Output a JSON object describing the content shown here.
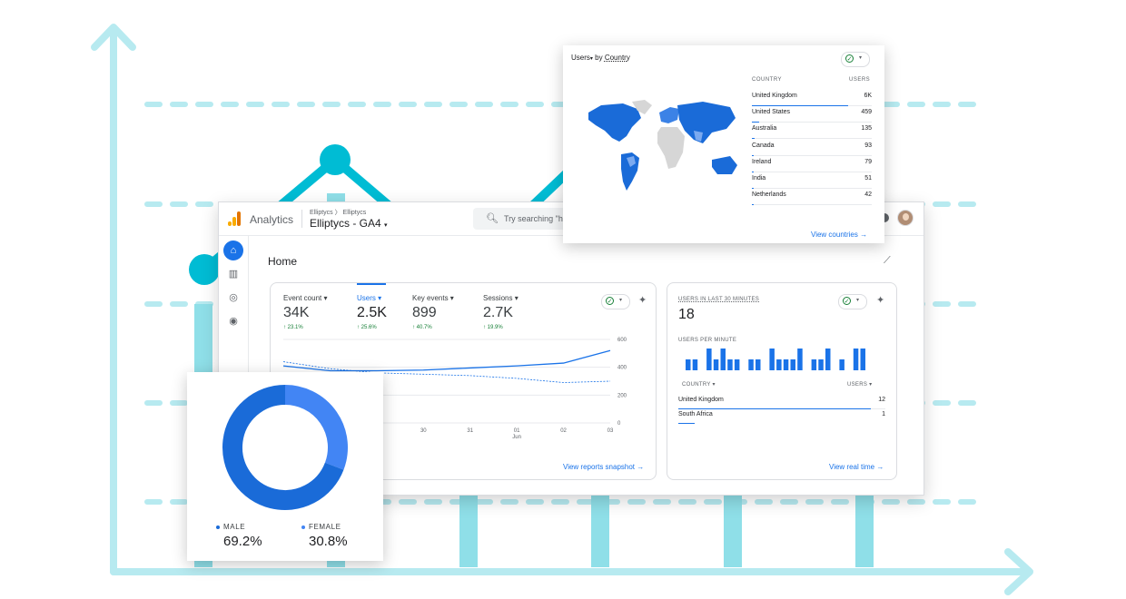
{
  "colors": {
    "accent": "#1a73e8",
    "light_blue": "#4285f4",
    "positive": "#188038",
    "teal": "#00bcd4",
    "teal_light": "#b2ebf2",
    "dash": "#b7eaf0"
  },
  "header": {
    "app_name": "Analytics",
    "breadcrumb": "Elliptycs 〉 Elliptycs",
    "property": "Elliptycs - GA4",
    "search_placeholder": "Try searching \"h"
  },
  "sidebar": {
    "items": [
      {
        "icon": "home-icon",
        "active": true
      },
      {
        "icon": "reports-icon",
        "active": false
      },
      {
        "icon": "explore-icon",
        "active": false
      },
      {
        "icon": "advertising-icon",
        "active": false
      }
    ]
  },
  "page": {
    "title": "Home"
  },
  "metrics": [
    {
      "label": "Event count",
      "value": "34K",
      "delta": "23.1%"
    },
    {
      "label": "Users",
      "value": "2.5K",
      "delta": "25.6%",
      "selected": true
    },
    {
      "label": "Key events",
      "value": "899",
      "delta": "40.7%"
    },
    {
      "label": "Sessions",
      "value": "2.7K",
      "delta": "19.9%"
    }
  ],
  "main_chart": {
    "y_ticks": [
      "600",
      "400",
      "200",
      "0"
    ],
    "x_ticks": [
      "30",
      "31",
      "01",
      "02",
      "03"
    ],
    "x_sub": "Jun",
    "link": "View reports snapshot"
  },
  "chart_data": {
    "type": "line",
    "x": [
      "",
      "",
      "",
      "30",
      "31",
      "01",
      "02",
      "03"
    ],
    "ylim": [
      0,
      600
    ],
    "series": [
      {
        "values": [
          410,
          375,
          375,
          380,
          395,
          410,
          430,
          520
        ]
      },
      {
        "values": [
          440,
          390,
          360,
          350,
          340,
          320,
          290,
          300
        ]
      }
    ]
  },
  "realtime": {
    "title": "USERS IN LAST 30 MINUTES",
    "value": "18",
    "per_minute_label": "USERS PER MINUTE",
    "per_minute": [
      1,
      1,
      0,
      2,
      1,
      2,
      1,
      1,
      0,
      1,
      1,
      0,
      2,
      1,
      1,
      1,
      2,
      0,
      1,
      1,
      2,
      0,
      1,
      0,
      2,
      2
    ],
    "country_header": "COUNTRY",
    "users_header": "USERS",
    "rows": [
      {
        "country": "United Kingdom",
        "users": "12",
        "share": 1.0
      },
      {
        "country": "South Africa",
        "users": "1",
        "share": 0.08
      }
    ],
    "link": "View real time"
  },
  "country_card": {
    "title_metric": "Users",
    "title_by": "by",
    "title_dimension": "Country",
    "col_country": "COUNTRY",
    "col_users": "USERS",
    "rows": [
      {
        "country": "United Kingdom",
        "users": "6K",
        "share": 0.8
      },
      {
        "country": "United States",
        "users": "459",
        "share": 0.06
      },
      {
        "country": "Australia",
        "users": "135",
        "share": 0.02
      },
      {
        "country": "Canada",
        "users": "93",
        "share": 0.015
      },
      {
        "country": "Ireland",
        "users": "79",
        "share": 0.013
      },
      {
        "country": "India",
        "users": "51",
        "share": 0.01
      },
      {
        "country": "Netherlands",
        "users": "42",
        "share": 0.008
      }
    ],
    "link": "View countries"
  },
  "gender": {
    "segments": [
      {
        "label": "MALE",
        "value": "69.2%",
        "share": 0.692,
        "color": "#1a6bd8"
      },
      {
        "label": "FEMALE",
        "value": "30.8%",
        "share": 0.308,
        "color": "#4285f4"
      }
    ]
  }
}
